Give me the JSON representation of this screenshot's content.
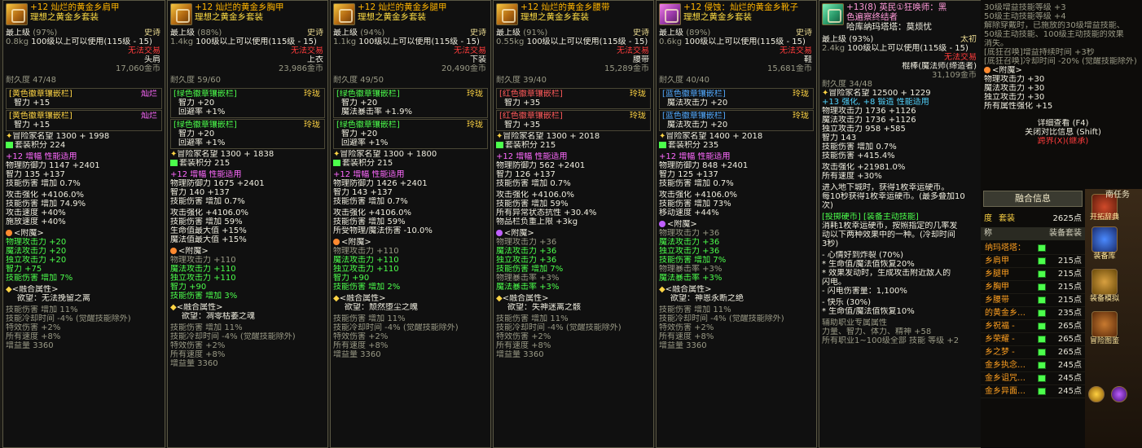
{
  "panels": [
    {
      "title": "+12 灿烂的黄金乡肩甲",
      "set": "理想之黄金乡套装",
      "level": "最上级",
      "pct": "(97%)",
      "rarity": "史诗",
      "weight": "0.8kg",
      "req": "100级以上可以使用(115级 - 15)",
      "trade": "无法交易",
      "slot": "头肩",
      "price": "17,060金币",
      "durability": "耐久度 47/48",
      "slots": [
        {
          "name": "[黄色徽章镶嵌栏]",
          "tag": "灿烂",
          "stat": "智力 +15"
        },
        {
          "name": "[黄色徽章镶嵌栏]",
          "tag": "灿烂",
          "stat": "智力 +15"
        }
      ],
      "fame": "冒险家名望 1300 + 1998",
      "setscore": "套装积分 224",
      "amp": "+12 增幅 性能适用",
      "lines1": [
        "物理防御力 1147 +2401",
        "智力 135 +137",
        "技能伤害 增加 0.7%"
      ],
      "lines2": [
        "攻击强化 +4106.0%",
        "技能伤害 增加 74.9%",
        "攻击速度 +40%",
        "施放速度 +40%"
      ],
      "enchant": "<附魔>",
      "lines3": [
        "物理攻击力 +20",
        "魔法攻击力 +20",
        "独立攻击力 +20",
        "智力 +75",
        "技能伤害 增加 7%"
      ],
      "fusion": "<融合属性>",
      "desire": "欲望：无法挽留之离",
      "lines4": [
        "技能伤害 增加 11%",
        "技能冷却时间 -4% (觉醒技能除外)",
        "特效伤害 +2%",
        "所有速度 +8%",
        "增益量 3360"
      ]
    },
    {
      "title": "+12 灿烂的黄金乡胸甲",
      "set": "理想之黄金乡套装",
      "level": "最上级",
      "pct": "(88%)",
      "rarity": "史诗",
      "weight": "1.4kg",
      "req": "100级以上可以使用(115级 - 15)",
      "trade": "无法交易",
      "slot": "上衣",
      "price": "23,986金币",
      "durability": "耐久度 59/60",
      "slots": [
        {
          "name": "[绿色徽章镶嵌栏]",
          "tag": "玲珑",
          "stat": "智力 +20",
          "stat2": "回避率 +1%"
        },
        {
          "name": "[绿色徽章镶嵌栏]",
          "tag": "玲珑",
          "stat": "智力 +20",
          "stat2": "回避率 +1%"
        }
      ],
      "fame": "冒险家名望 1300 + 1838",
      "setscore": "套装积分 215",
      "amp": "+12 增幅 性能适用",
      "lines1": [
        "物理防御力 1675 +2401",
        "智力 140 +137",
        "技能伤害 增加 0.7%"
      ],
      "lines2": [
        "攻击强化 +4106.0%",
        "技能伤害 增加 59%",
        "生命值最大值 +15%",
        "魔法值最大值 +15%"
      ],
      "enchant": "<附魔>",
      "lines3": [
        "物理攻击力 +110",
        "魔法攻击力 +110",
        "独立攻击力 +110",
        "智力 +90",
        "技能伤害 增加 3%"
      ],
      "fusion": "<融合属性>",
      "desire": "欲望：凋零枯萎之魂",
      "lines4": [
        "技能伤害 增加 11%",
        "技能冷却时间 -4% (觉醒技能除外)",
        "特效伤害 +2%",
        "所有速度 +8%",
        "增益量 3360"
      ]
    },
    {
      "title": "+12 灿烂的黄金乡腿甲",
      "set": "理想之黄金乡套装",
      "level": "最上级",
      "pct": "(94%)",
      "rarity": "史诗",
      "weight": "1.1kg",
      "req": "100级以上可以使用(115级 - 15)",
      "trade": "无法交易",
      "slot": "下装",
      "price": "20,490金币",
      "durability": "耐久度 49/50",
      "slots": [
        {
          "name": "[绿色徽章镶嵌栏]",
          "tag": "玲珑",
          "stat": "智力 +20",
          "stat2": "魔法暴击率 +1.9%"
        },
        {
          "name": "[绿色徽章镶嵌栏]",
          "tag": "玲珑",
          "stat": "智力 +20",
          "stat2": "回避率 +1%"
        }
      ],
      "fame": "冒险家名望 1300 + 1800",
      "setscore": "套装积分 215",
      "amp": "+12 增幅 性能适用",
      "lines1": [
        "物理防御力 1426 +2401",
        "智力 143 +137",
        "技能伤害 增加 0.7%"
      ],
      "lines2": [
        "攻击强化 +4106.0%",
        "技能伤害 增加 59%",
        "所受物理/魔法伤害 -10.0%"
      ],
      "enchant": "<附魔>",
      "lines3": [
        "物理攻击力 +110",
        "魔法攻击力 +110",
        "独立攻击力 +110",
        "智力 +90",
        "技能伤害 增加 2%"
      ],
      "fusion": "<融合属性>",
      "desire": "欲望：颓然堕尘之魄",
      "lines4": [
        "技能伤害 增加 11%",
        "技能冷却时间 -4% (觉醒技能除外)",
        "特效伤害 +2%",
        "所有速度 +8%",
        "增益量 3360"
      ]
    },
    {
      "title": "+12 灿烂的黄金乡腰带",
      "set": "理想之黄金乡套装",
      "level": "最上级",
      "pct": "(91%)",
      "rarity": "史诗",
      "weight": "0.55kg",
      "req": "100级以上可以使用(115级 - 15)",
      "trade": "无法交易",
      "slot": "腰带",
      "price": "15,289金币",
      "durability": "耐久度 39/40",
      "slots": [
        {
          "name": "[红色徽章镶嵌栏]",
          "tag": "玲珑",
          "stat": "智力 +35"
        },
        {
          "name": "[红色徽章镶嵌栏]",
          "tag": "玲珑",
          "stat": "智力 +35"
        }
      ],
      "fame": "冒险家名望 1300 + 2018",
      "setscore": "套装积分 215",
      "amp": "+12 增幅 性能适用",
      "lines1": [
        "物理防御力 562 +2401",
        "智力 126 +137",
        "技能伤害 增加 0.7%"
      ],
      "lines2": [
        "攻击强化 +4106.0%",
        "技能伤害 增加 59%",
        "所有异常状态抗性 +30.4%",
        "物品栏负重上限 +3kg"
      ],
      "enchant": "<附魔>",
      "lines3": [
        "物理攻击力 +36",
        "魔法攻击力 +36",
        "独立攻击力 +36",
        "技能伤害 增加 7%",
        "物理暴击率 +3%",
        "魔法暴击率 +3%"
      ],
      "fusion": "<融合属性>",
      "desire": "欲望：失神迷离之骸",
      "lines4": [
        "技能伤害 增加 11%",
        "技能冷却时间 -4% (觉醒技能除外)",
        "特效伤害 +2%",
        "所有速度 +8%",
        "增益量 3360"
      ]
    },
    {
      "title": "+12 侵蚀：灿烂的黄金乡靴子",
      "set": "理想之黄金乡套装",
      "level": "最上级",
      "pct": "(89%)",
      "rarity": "史诗",
      "weight": "0.6kg",
      "req": "100级以上可以使用(115级 - 15)",
      "trade": "无法交易",
      "slot": "鞋",
      "price": "15,681金币",
      "durability": "耐久度 40/40",
      "slots": [
        {
          "name": "[蓝色徽章镶嵌栏]",
          "tag": "玲珑",
          "stat": "魔法攻击力 +20"
        },
        {
          "name": "[蓝色徽章镶嵌栏]",
          "tag": "玲珑",
          "stat": "魔法攻击力 +20"
        }
      ],
      "fame": "冒险家名望 1400 + 2018",
      "setscore": "套装积分 235",
      "amp": "+12 增幅 性能适用",
      "lines1": [
        "物理防御力 848 +2401",
        "智力 125 +137",
        "技能伤害 增加 0.7%"
      ],
      "lines2": [
        "攻击强化 +4106.0%",
        "技能伤害 增加 73%",
        "移动速度 +44%"
      ],
      "enchant": "<附魔>",
      "lines3": [
        "物理攻击力 +36",
        "魔法攻击力 +36",
        "独立攻击力 +36",
        "技能伤害 增加 7%",
        "物理暴击率 +3%",
        "魔法暴击率 +3%"
      ],
      "fusion": "<融合属性>",
      "desire": "欲望：神恩永断之绝",
      "lines4": [
        "技能伤害 增加 11%",
        "技能冷却时间 -4% (觉醒技能除外)",
        "特效伤害 +2%",
        "所有速度 +8%",
        "增益量 3360"
      ]
    }
  ],
  "weapon": {
    "title": "+13(8) 英民①狂唤师：黑",
    "title2": "色遍察终结者",
    "sub": "哈库纳玛塔塔：莫烦忧",
    "level": "最上级",
    "pct": "(93%)",
    "rarity": "太初",
    "weight": "2.4kg",
    "req": "100级以上可以使用(115级 - 15)",
    "trade": "无法交易",
    "type": "棍棒(魔法师(缔造者)",
    "price": "31,109金币",
    "durability": "耐久度 34/48",
    "fame": "冒险家名望 12500 + 1229",
    "enh": "+13 强化, +8 锻造 性能适用",
    "lines1": [
      "物理攻击力 1736 +1126",
      "魔法攻击力 1736 +1126",
      "独立攻击力 958 +585",
      "智力 143",
      "技能伤害 增加 0.7%",
      "技能伤害 +415.4%"
    ],
    "lines2": [
      "攻击强化 +21981.0%",
      "所有速度 +30%"
    ],
    "para1": [
      "进入地下城时，获得1枚幸运硬币。",
      "每10秒获得1枚幸运硬币。(最多叠加10",
      "次)"
    ],
    "skill_hdr": "[投掷硬币] [装备主动技能]",
    "para2": [
      "消耗1枚幸运硬币，按照指定的几率发",
      "动以下两种效果中的一种。(冷却时间",
      "3秒)"
    ],
    "eff1": [
      "- 心情好到炸裂 (70%)",
      "  * 生命值/魔法值恢复20%",
      "  * 效果发动时，生成攻击附近敌人的",
      "  闪电。",
      "  - 闪电伤害量：1,100%"
    ],
    "eff2": [
      "- 快乐 (30%)",
      "  * 生命值/魔法值恢复10%"
    ],
    "tail": [
      "辅助职业专属属性",
      "力量、智力、体力、精神 +58",
      "所有职业1~100级全部 技能 等级 +2"
    ]
  },
  "side": {
    "lines": [
      "30级增益技能等级 +3",
      "50级主动技能等级 +4",
      "解除穿戴时，已施放的30级增益技能、",
      "50级主动技能、100级主动技能的效果",
      "消失。",
      "[底狂召唤]增益持续时间 +3秒",
      "[底狂召唤]冷却时间 -20% (觉醒技能除外)"
    ],
    "enchant": "<附魔>",
    "ench_lines": [
      "物理攻击力 +30",
      "魔法攻击力 +30",
      "独立攻击力 +30",
      "所有属性强化 +15"
    ],
    "detail": "详细查看 (F4)",
    "compare": "关闭对比信息 (Shift)",
    "cross": "跨界(X)(继承)",
    "fusion_title": "融合信息",
    "col_level": "度",
    "col_set": "套装",
    "col_score": "2625点",
    "col_name": "称",
    "col_equip": "装备套装",
    "rows": [
      {
        "name": "纳玛塔塔：",
        "score": ""
      },
      {
        "name": "乡肩甲",
        "score": "215点"
      },
      {
        "name": "乡腿甲",
        "score": "215点"
      },
      {
        "name": "乡胸甲",
        "score": "215点"
      },
      {
        "name": "乡腰带",
        "score": "215点"
      },
      {
        "name": "的黄金乡…",
        "score": "235点"
      },
      {
        "name": "乡祝福 -",
        "score": "265点"
      },
      {
        "name": "乡荣耀 -",
        "score": "265点"
      },
      {
        "name": "乡之梦 -",
        "score": "265点"
      },
      {
        "name": "金乡执念…",
        "score": "245点"
      },
      {
        "name": "金乡诅咒…",
        "score": "245点"
      },
      {
        "name": "金乡异面…",
        "score": "245点"
      }
    ],
    "btns": [
      "开拓辞典",
      "装备库",
      "装备模拟",
      "冒险图鉴"
    ],
    "top_right": "南任务"
  }
}
